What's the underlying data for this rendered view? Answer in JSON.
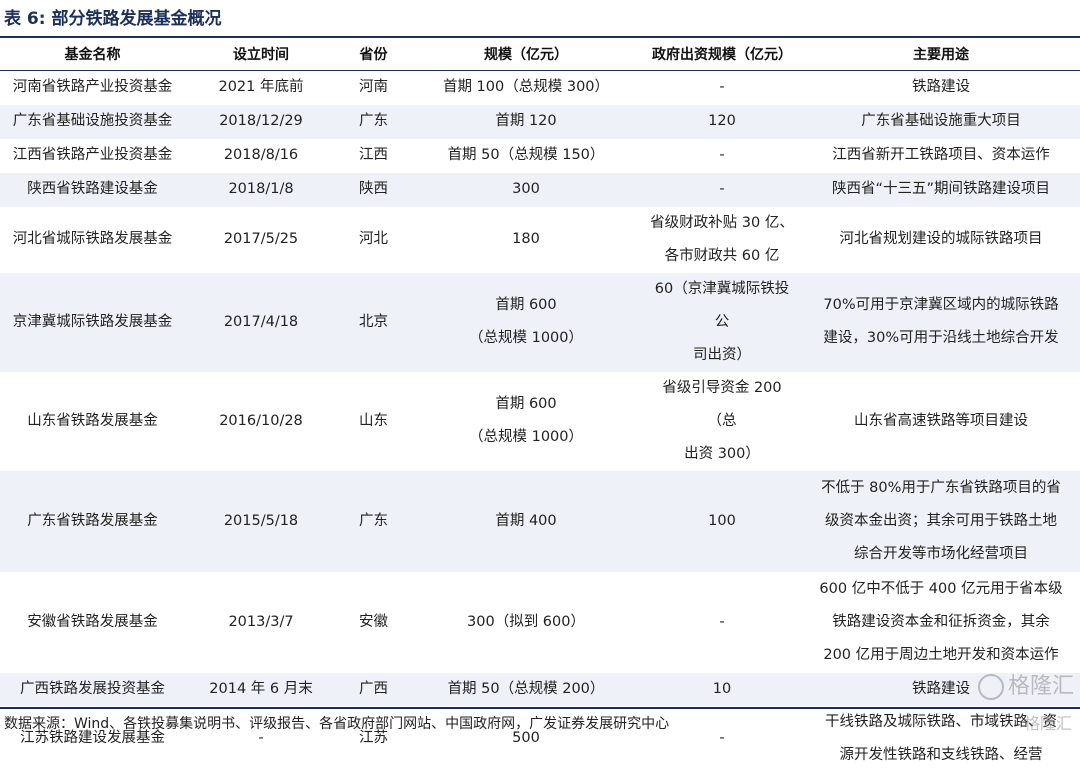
{
  "title": "表 6:  部分铁路发展基金概况",
  "columns": [
    "基金名称",
    "设立时间",
    "省份",
    "规模（亿元）",
    "政府出资规模（亿元）",
    "主要用途"
  ],
  "rows": [
    {
      "name": "河南省铁路产业投资基金",
      "date": "2021 年底前",
      "province": "河南",
      "scale": [
        "首期 100（总规模 300）"
      ],
      "gov": [
        "-"
      ],
      "use": [
        "铁路建设"
      ]
    },
    {
      "name": "广东省基础设施投资基金",
      "date": "2018/12/29",
      "province": "广东",
      "scale": [
        "首期 120"
      ],
      "gov": [
        "120"
      ],
      "use": [
        "广东省基础设施重大项目"
      ]
    },
    {
      "name": "江西省铁路产业投资基金",
      "date": "2018/8/16",
      "province": "江西",
      "scale": [
        "首期 50（总规模 150）"
      ],
      "gov": [
        "-"
      ],
      "use": [
        "江西省新开工铁路项目、资本运作"
      ]
    },
    {
      "name": "陕西省铁路建设基金",
      "date": "2018/1/8",
      "province": "陕西",
      "scale": [
        "300"
      ],
      "gov": [
        "-"
      ],
      "use": [
        "陕西省“十三五”期间铁路建设项目"
      ]
    },
    {
      "name": "河北省城际铁路发展基金",
      "date": "2017/5/25",
      "province": "河北",
      "scale": [
        "180"
      ],
      "gov": [
        "省级财政补贴 30 亿、",
        "各市财政共 60 亿"
      ],
      "use": [
        "河北省规划建设的城际铁路项目"
      ]
    },
    {
      "name": "京津冀城际铁路发展基金",
      "date": "2017/4/18",
      "province": "北京",
      "scale": [
        "首期 600",
        "（总规模 1000）"
      ],
      "gov": [
        "60（京津冀城际铁投公",
        "司出资）"
      ],
      "use": [
        "70%可用于京津冀区域内的城际铁路",
        "建设，30%可用于沿线土地综合开发"
      ]
    },
    {
      "name": "山东省铁路发展基金",
      "date": "2016/10/28",
      "province": "山东",
      "scale": [
        "首期 600",
        "（总规模 1000）"
      ],
      "gov": [
        "省级引导资金 200（总",
        "出资 300）"
      ],
      "use": [
        "山东省高速铁路等项目建设"
      ]
    },
    {
      "name": "广东省铁路发展基金",
      "date": "2015/5/18",
      "province": "广东",
      "scale": [
        "首期 400"
      ],
      "gov": [
        "100"
      ],
      "use": [
        "不低于 80%用于广东省铁路项目的省",
        "级资本金出资；其余可用于铁路土地",
        "综合开发等市场化经营项目"
      ]
    },
    {
      "name": "安徽省铁路发展基金",
      "date": "2013/3/7",
      "province": "安徽",
      "scale": [
        "300（拟到 600）"
      ],
      "gov": [
        "-"
      ],
      "use": [
        "600 亿中不低于 400 亿元用于省本级",
        "铁路建设资本金和征拆资金，其余",
        "200 亿用于周边土地开发和资本运作"
      ]
    },
    {
      "name": "广西铁路发展投资基金",
      "date": "2014 年 6 月末",
      "province": "广西",
      "scale": [
        "首期 50（总规模 200）"
      ],
      "gov": [
        "10"
      ],
      "use": [
        "铁路建设"
      ]
    },
    {
      "name": "江苏铁路建设发展基金",
      "date": "-",
      "province": "江苏",
      "scale": [
        "500"
      ],
      "gov": [
        "-"
      ],
      "use": [
        "干线铁路及城际铁路、市域铁路、资",
        "源开发性铁路和支线铁路、经营"
      ]
    }
  ],
  "source": "数据来源：Wind、各铁投募集说明书、评级报告、各省政府部门网站、中国政府网，广发证券发展研究中心",
  "watermark": "格隆汇",
  "watermark_small": "格隆汇"
}
